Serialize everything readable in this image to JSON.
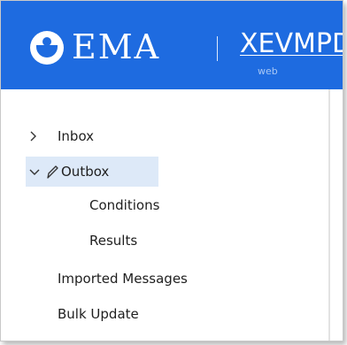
{
  "header": {
    "logo_text": "EMA",
    "app_title": "XEVMPD",
    "app_subtitle": "web",
    "background_color": "#1e6be0"
  },
  "sidebar": {
    "items": [
      {
        "label": "Inbox",
        "icon": "chevron-right-icon",
        "expanded": false
      },
      {
        "label": "Outbox",
        "icon": "chevron-down-icon",
        "extra_icon": "pencil-icon",
        "expanded": true,
        "selected": true,
        "children": [
          {
            "label": "Conditions"
          },
          {
            "label": "Results"
          }
        ]
      },
      {
        "label": "Imported Messages"
      },
      {
        "label": "Bulk Update"
      }
    ],
    "selected_color": "#dde9f8"
  }
}
